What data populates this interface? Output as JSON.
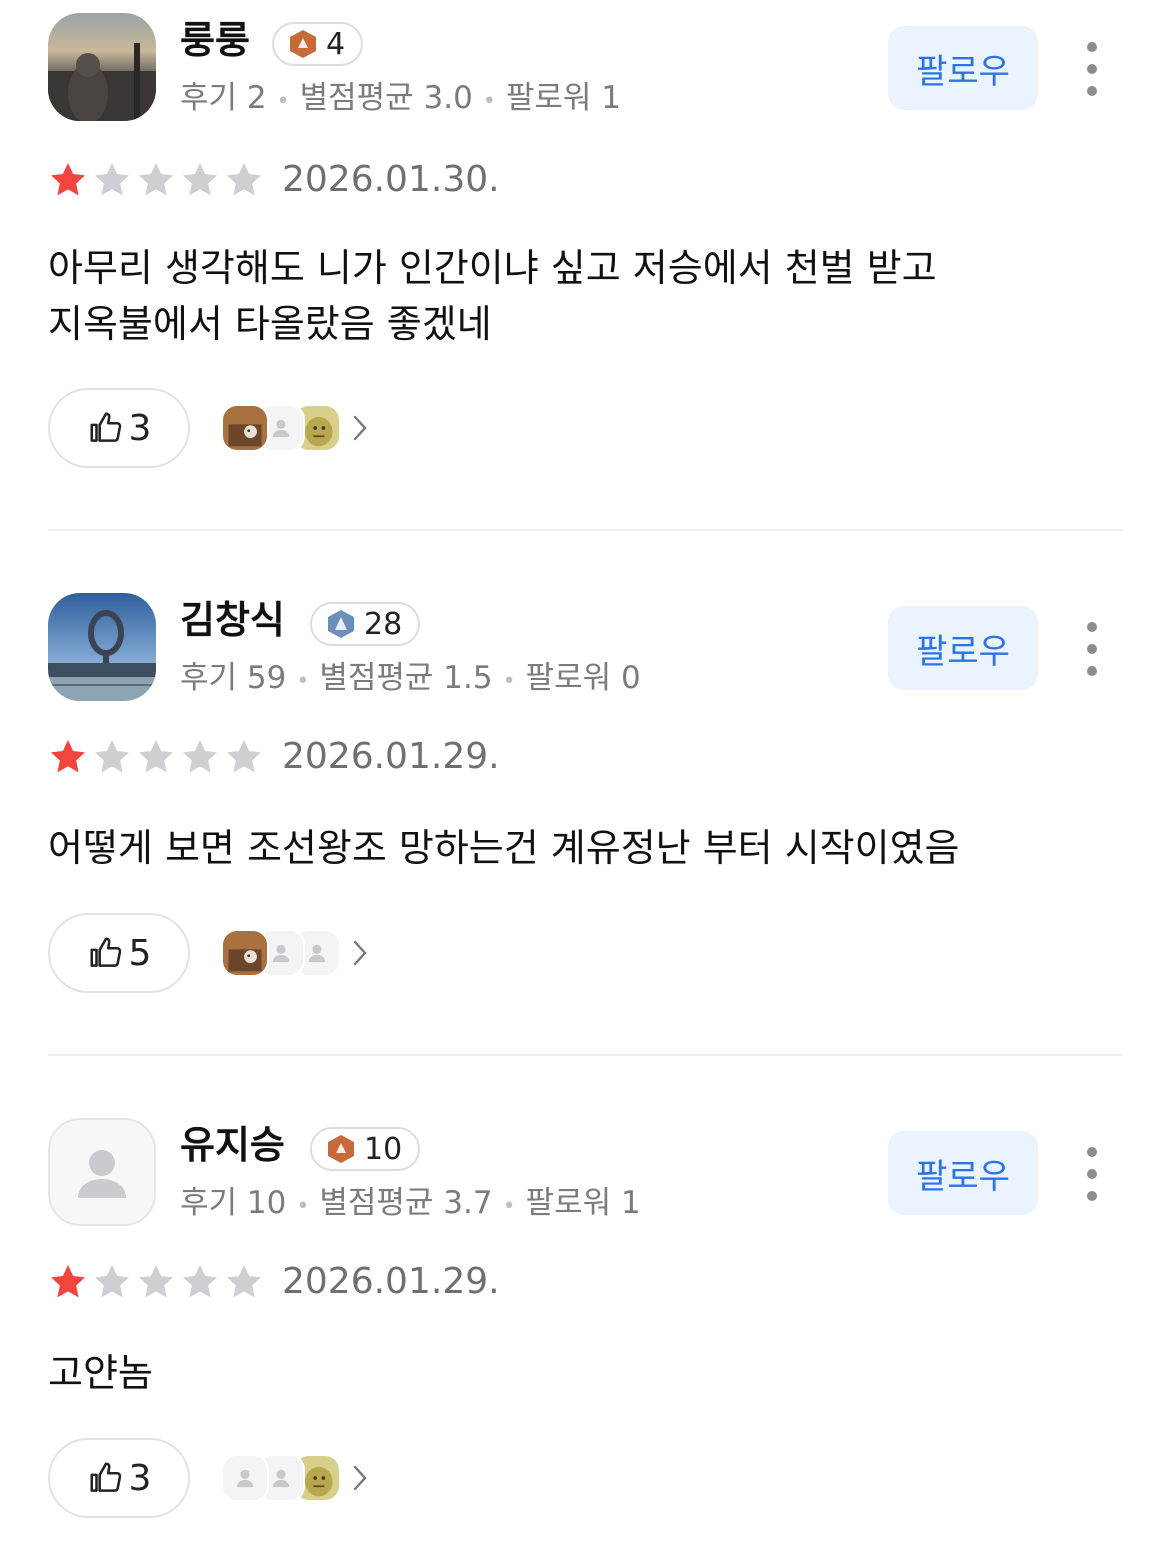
{
  "reviews": [
    {
      "name": "룽룽",
      "level": "4",
      "level_color": "#c8693a",
      "meta": {
        "reviews": "후기 2",
        "avg": "별점평균 3.0",
        "followers": "팔로워 1"
      },
      "follow_label": "팔로우",
      "rating": 1,
      "date": "2026.01.30.",
      "text": "아무리 생각해도 니가 인간이냐 싶고 저승에서 천벌 받고\n지옥불에서 타올랐음 좋겠네",
      "likes": "3",
      "likers": [
        "cat-photo-avatar",
        "default-avatar",
        "character-avatar"
      ]
    },
    {
      "name": "김창식",
      "level": "28",
      "level_color": "#6b8fb8",
      "meta": {
        "reviews": "후기 59",
        "avg": "별점평균 1.5",
        "followers": "팔로워 0"
      },
      "follow_label": "팔로우",
      "rating": 1,
      "date": "2026.01.29.",
      "text": "어떻게 보면 조선왕조 망하는건 계유정난 부터 시작이였음",
      "likes": "5",
      "likers": [
        "cat-photo-avatar",
        "default-avatar",
        "default-avatar"
      ]
    },
    {
      "name": "유지승",
      "level": "10",
      "level_color": "#c8693a",
      "meta": {
        "reviews": "후기 10",
        "avg": "별점평균 3.7",
        "followers": "팔로워 1"
      },
      "follow_label": "팔로우",
      "rating": 1,
      "date": "2026.01.29.",
      "text": "고얀놈",
      "likes": "3",
      "likers": [
        "default-avatar",
        "default-avatar",
        "character-avatar"
      ]
    }
  ],
  "colors": {
    "star_on": "#f2453d",
    "star_off": "#cfcfd3",
    "follow_text": "#2b74e6",
    "follow_bg": "#ebf3fe"
  }
}
